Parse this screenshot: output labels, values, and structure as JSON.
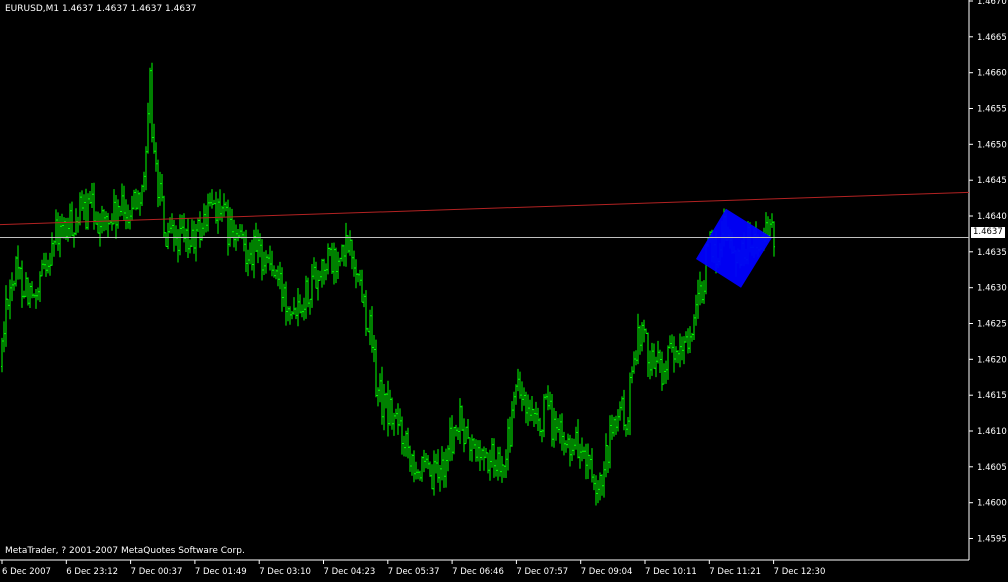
{
  "header": {
    "symbol_label": "EURUSD,M1 1.4637 1.4637 1.4637 1.4637"
  },
  "footer": {
    "copyright": "MetaTrader, ? 2001-2007 MetaQuotes Software Corp."
  },
  "price_axis": {
    "current_price_label": "1.4637"
  },
  "colors": {
    "background": "#000000",
    "candles": "#00ff00",
    "axis": "#ffffff",
    "trendline": "#b22222",
    "current_price_line": "#c0c0c0",
    "shape_fill": "#0000ff",
    "price_tag_bg": "#ffffff"
  },
  "chart_data": {
    "type": "bar",
    "symbol": "EURUSD",
    "timeframe": "M1",
    "ylim": [
      1.4592,
      1.467
    ],
    "y_ticks": [
      "1.4670",
      "1.4665",
      "1.4660",
      "1.4655",
      "1.4650",
      "1.4645",
      "1.4640",
      "1.4635",
      "1.4630",
      "1.4625",
      "1.4620",
      "1.4615",
      "1.4610",
      "1.4605",
      "1.4600",
      "1.4595"
    ],
    "x_ticks": [
      "6 Dec 2007",
      "6 Dec 23:12",
      "7 Dec 00:37",
      "7 Dec 01:49",
      "7 Dec 03:10",
      "7 Dec 04:23",
      "7 Dec 05:37",
      "7 Dec 06:46",
      "7 Dec 07:57",
      "7 Dec 09:04",
      "7 Dec 10:11",
      "7 Dec 11:21",
      "7 Dec 12:30"
    ],
    "current_price": 1.4637,
    "trendline": {
      "start_price": 1.46388,
      "end_price": 1.46433
    },
    "price_path": [
      [
        0,
        1.4619
      ],
      [
        8,
        1.463
      ],
      [
        16,
        1.4632
      ],
      [
        28,
        1.463
      ],
      [
        36,
        1.4627
      ],
      [
        44,
        1.4633
      ],
      [
        54,
        1.4637
      ],
      [
        66,
        1.4638
      ],
      [
        78,
        1.464
      ],
      [
        92,
        1.4641
      ],
      [
        104,
        1.4639
      ],
      [
        116,
        1.464
      ],
      [
        130,
        1.4641
      ],
      [
        140,
        1.4644
      ],
      [
        146,
        1.4647
      ],
      [
        150,
        1.4658
      ],
      [
        154,
        1.4648
      ],
      [
        160,
        1.4643
      ],
      [
        166,
        1.4636
      ],
      [
        176,
        1.4637
      ],
      [
        186,
        1.4636
      ],
      [
        196,
        1.4637
      ],
      [
        206,
        1.464
      ],
      [
        214,
        1.4642
      ],
      [
        222,
        1.464
      ],
      [
        232,
        1.4637
      ],
      [
        244,
        1.4636
      ],
      [
        256,
        1.4635
      ],
      [
        268,
        1.4634
      ],
      [
        280,
        1.463
      ],
      [
        292,
        1.4628
      ],
      [
        304,
        1.4629
      ],
      [
        316,
        1.4632
      ],
      [
        326,
        1.4634
      ],
      [
        336,
        1.4633
      ],
      [
        342,
        1.4634
      ],
      [
        348,
        1.4636
      ],
      [
        356,
        1.4633
      ],
      [
        364,
        1.4628
      ],
      [
        370,
        1.4624
      ],
      [
        376,
        1.4617
      ],
      [
        382,
        1.4614
      ],
      [
        392,
        1.4612
      ],
      [
        402,
        1.461
      ],
      [
        412,
        1.4607
      ],
      [
        422,
        1.4604
      ],
      [
        432,
        1.4603
      ],
      [
        442,
        1.4605
      ],
      [
        452,
        1.4609
      ],
      [
        460,
        1.4611
      ],
      [
        468,
        1.4608
      ],
      [
        478,
        1.4607
      ],
      [
        488,
        1.4606
      ],
      [
        498,
        1.4606
      ],
      [
        508,
        1.4608
      ],
      [
        518,
        1.4617
      ],
      [
        526,
        1.4612
      ],
      [
        536,
        1.461
      ],
      [
        546,
        1.4613
      ],
      [
        556,
        1.461
      ],
      [
        564,
        1.4608
      ],
      [
        574,
        1.4609
      ],
      [
        582,
        1.4607
      ],
      [
        590,
        1.4604
      ],
      [
        596,
        1.4599
      ],
      [
        604,
        1.4604
      ],
      [
        612,
        1.461
      ],
      [
        620,
        1.4613
      ],
      [
        626,
        1.4611
      ],
      [
        632,
        1.4617
      ],
      [
        638,
        1.4625
      ],
      [
        646,
        1.4622
      ],
      [
        654,
        1.462
      ],
      [
        662,
        1.4619
      ],
      [
        670,
        1.462
      ],
      [
        680,
        1.462
      ],
      [
        686,
        1.4623
      ],
      [
        694,
        1.4625
      ],
      [
        700,
        1.4628
      ],
      [
        706,
        1.4634
      ],
      [
        712,
        1.4636
      ],
      [
        718,
        1.4634
      ],
      [
        724,
        1.464
      ],
      [
        730,
        1.4636
      ],
      [
        736,
        1.4634
      ],
      [
        742,
        1.4635
      ],
      [
        750,
        1.4637
      ],
      [
        758,
        1.4636
      ],
      [
        766,
        1.4637
      ],
      [
        774,
        1.4637
      ]
    ],
    "annotation_shape": {
      "type": "rectangle",
      "fill": "#0000ff",
      "corners": [
        [
          696,
          1.4634
        ],
        [
          726,
          1.4641
        ],
        [
          772,
          1.4637
        ],
        [
          741,
          1.463
        ]
      ]
    }
  }
}
